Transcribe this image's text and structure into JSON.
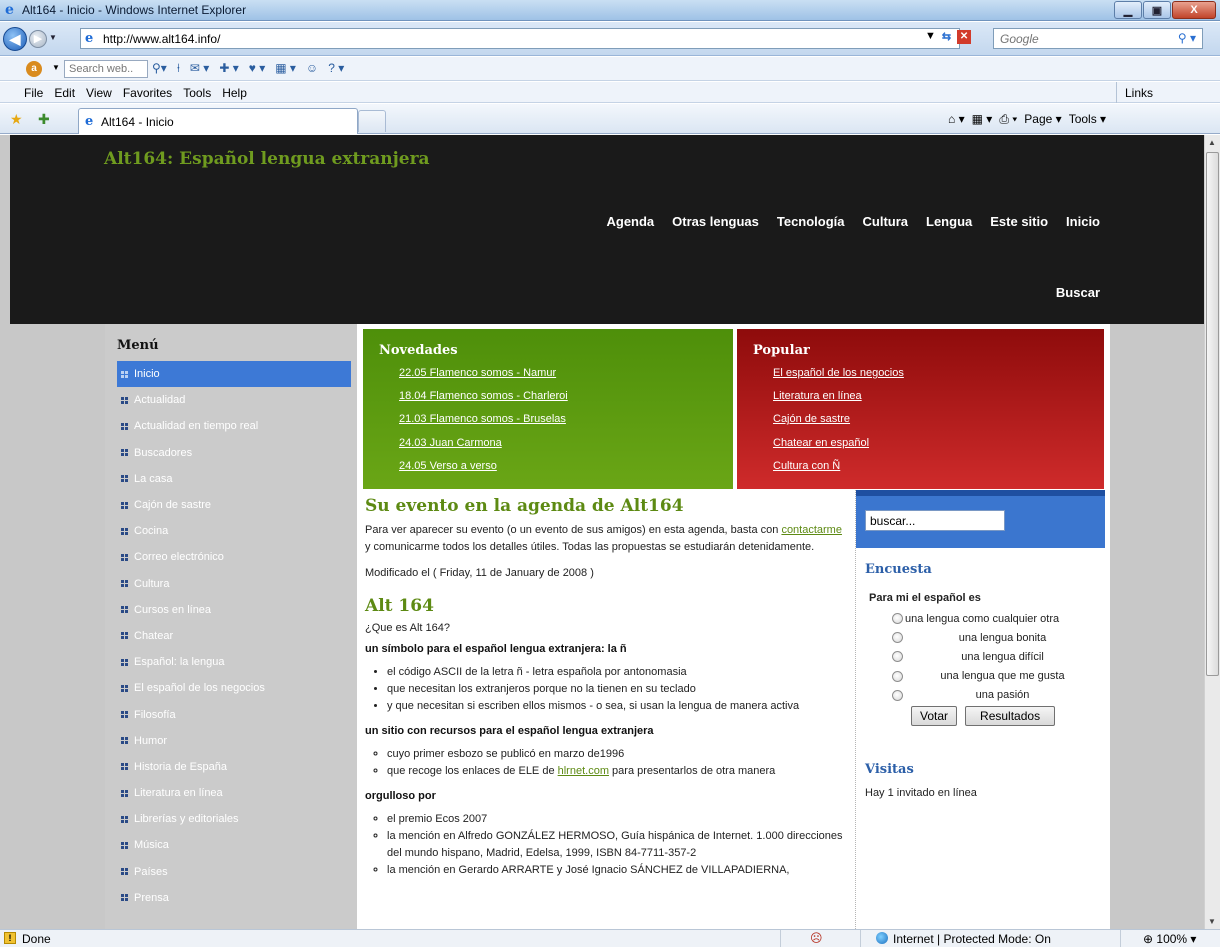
{
  "window": {
    "title": "Alt164 - Inicio - Windows Internet Explorer",
    "minimize": "▁",
    "maximize": "▣",
    "close": "X"
  },
  "address": {
    "url": "http://www.alt164.info/",
    "search_placeholder": "Google"
  },
  "search_toolbar": {
    "placeholder": "Search web.."
  },
  "menubar": {
    "items": [
      "File",
      "Edit",
      "View",
      "Favorites",
      "Tools",
      "Help"
    ],
    "links": "Links"
  },
  "tabs": {
    "active_title": "Alt164 - Inicio"
  },
  "commandbar": {
    "page": "Page ▾",
    "tools": "Tools ▾"
  },
  "site": {
    "title": "Alt164: Español lengua extranjera",
    "nav": [
      "Agenda",
      "Otras lenguas",
      "Tecnología",
      "Cultura",
      "Lengua",
      "Este sitio",
      "Inicio"
    ],
    "search_link": "Buscar"
  },
  "sidebar": {
    "title": "Menú",
    "items": [
      "Inicio",
      "Actualidad",
      "Actualidad en tiempo real",
      "Buscadores",
      "La casa",
      "Cajón de sastre",
      "Cocina",
      "Correo electrónico",
      "Cultura",
      "Cursos en línea",
      "Chatear",
      "Español: la lengua",
      "El español de los negocios",
      "Filosofía",
      "Humor",
      "Historia de España",
      "Literatura en línea",
      "Librerías y editoriales",
      "Música",
      "Países",
      "Prensa"
    ]
  },
  "novedades": {
    "title": "Novedades",
    "items": [
      "22.05 Flamenco somos - Namur",
      "18.04 Flamenco somos - Charleroi",
      "21.03 Flamenco somos - Bruselas",
      "24.03 Juan Carmona",
      "24.05 Verso a verso"
    ]
  },
  "popular": {
    "title": "Popular",
    "items": [
      "El español de los negocios",
      "Literatura en línea",
      "Cajón de sastre",
      "Chatear en español",
      "Cultura con Ñ"
    ]
  },
  "article1": {
    "title": "Su evento en la agenda de Alt164",
    "text_before": "Para ver aparecer su evento (o un evento de sus amigos) en esta agenda, basta con ",
    "link": "contactarme",
    "text_after": " y comunicarme todos los detalles útiles. Todas las propuestas se estudiarán detenidamente.",
    "modified": "Modificado el ( Friday, 11 de January de 2008 )"
  },
  "article2": {
    "title": "Alt 164",
    "question": "¿Que es Alt 164?",
    "h1": "un símbolo para el español lengua extranjera: la ñ",
    "bullets1": [
      "el código ASCII de la letra ñ - letra española por antonomasia",
      "que necesitan los extranjeros porque no la tienen en su teclado",
      "y que necesitan si escriben ellos mismos - o sea, si usan la lengua de manera activa"
    ],
    "h2": "un sitio con recursos para el español lengua extranjera",
    "b2_1": "cuyo primer esbozo se publicó en marzo de1996",
    "b2_2_before": "que recoge los enlaces de ELE de ",
    "b2_2_link": "hlrnet.com",
    "b2_2_after": " para presentarlos de otra manera",
    "h3": "orgulloso por",
    "b3_1": "el premio Ecos 2007",
    "b3_2": "la mención en Alfredo GONZÁLEZ HERMOSO, Guía hispánica de Internet. 1.000 direcciones del mundo hispano, Madrid, Edelsa, 1999, ISBN 84-7711-357-2",
    "b3_3": "la mención en Gerardo ARRARTE y José Ignacio SÁNCHEZ de VILLAPADIERNA,"
  },
  "right": {
    "search_value": "buscar...",
    "poll_title": "Encuesta",
    "poll_question": "Para mi el español es",
    "poll_options": [
      "una lengua como cualquier otra",
      "una lengua bonita",
      "una lengua difícil",
      "una lengua que me gusta",
      "una pasión"
    ],
    "vote": "Votar",
    "results": "Resultados",
    "visits_title": "Visitas",
    "online": "Hay 1 invitado en línea"
  },
  "status": {
    "left": "Done",
    "zone": "Internet | Protected Mode: On",
    "zoom": "100%"
  }
}
